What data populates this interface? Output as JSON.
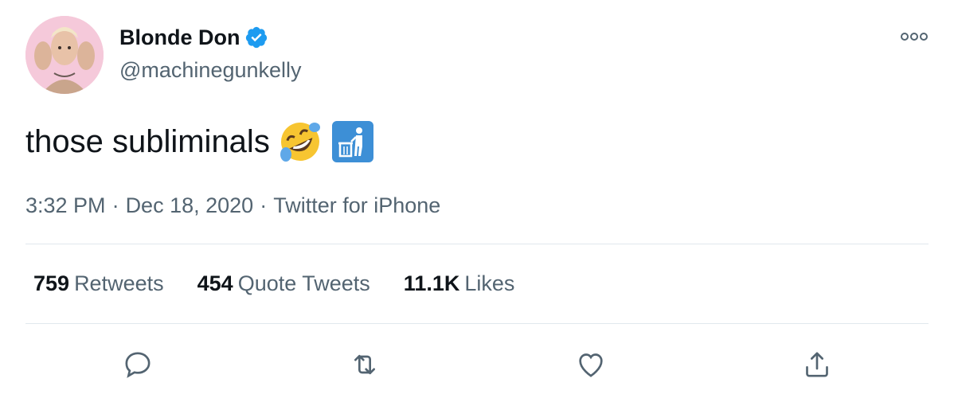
{
  "user": {
    "display_name": "Blonde Don",
    "handle": "@machinegunkelly",
    "verified": true
  },
  "tweet": {
    "text": "those subliminals",
    "emojis": [
      "rolling-on-floor-laughing-emoji",
      "litter-in-bin-sign-emoji"
    ]
  },
  "meta": {
    "time": "3:32 PM",
    "separator1": "·",
    "date": "Dec 18, 2020",
    "separator2": "·",
    "source": "Twitter for iPhone"
  },
  "stats": {
    "retweets": {
      "count": "759",
      "label": "Retweets"
    },
    "quote_tweets": {
      "count": "454",
      "label": "Quote Tweets"
    },
    "likes": {
      "count": "11.1K",
      "label": "Likes"
    }
  },
  "actions": [
    "reply-icon",
    "retweet-icon",
    "like-icon",
    "share-icon"
  ],
  "colors": {
    "text_primary": "#0f1419",
    "text_secondary": "#536471",
    "verified_blue": "#1d9bf0",
    "divider": "#e1e8ed"
  }
}
